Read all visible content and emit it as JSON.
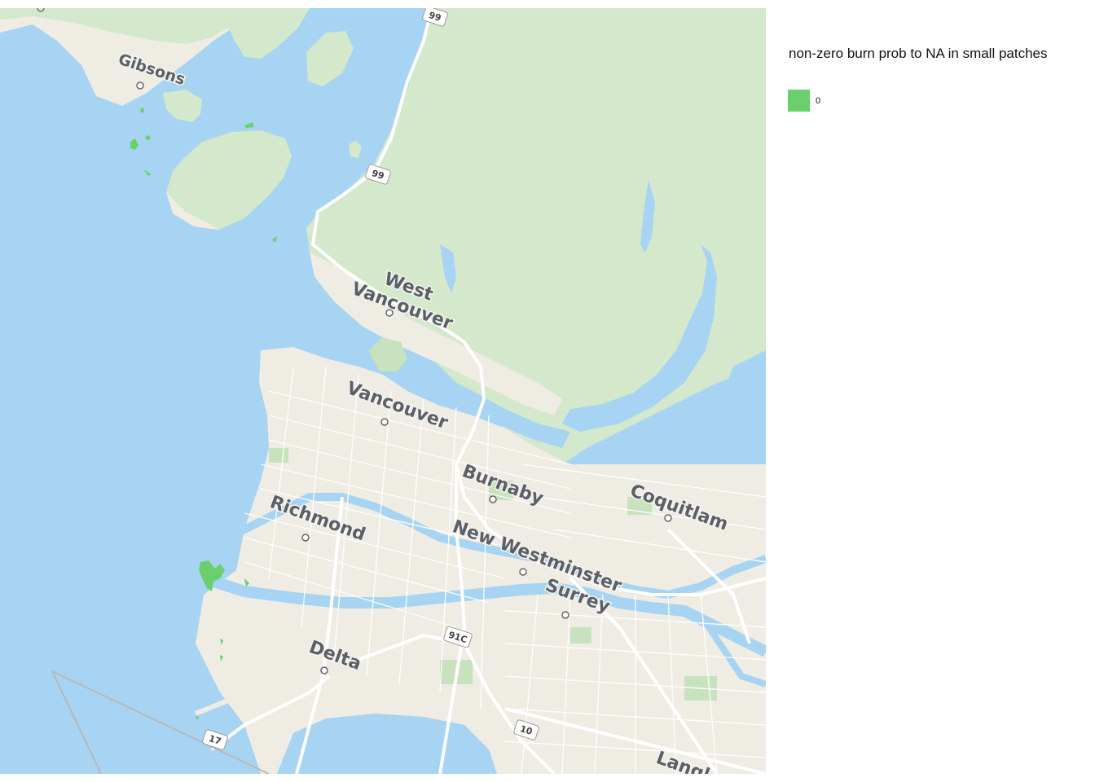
{
  "map": {
    "region": "Greater Vancouver / Howe Sound",
    "colors": {
      "water": "#a6d4f2",
      "land": "#efece4",
      "forest": "#d4e8cb",
      "park": "#c8e2bd",
      "roads": "#ffffff",
      "burn_patch": "#6bcf6e"
    },
    "places": [
      {
        "label": "Gibsons"
      },
      {
        "label": "West"
      },
      {
        "label": "Vancouver"
      },
      {
        "label": "Vancouver"
      },
      {
        "label": "Burnaby"
      },
      {
        "label": "Coquitlam"
      },
      {
        "label": "Richmond"
      },
      {
        "label": "New Westminster"
      },
      {
        "label": "Surrey"
      },
      {
        "label": "Delta"
      },
      {
        "label": "Langl"
      }
    ],
    "shields": [
      {
        "label": "99"
      },
      {
        "label": "99"
      },
      {
        "label": "91C"
      },
      {
        "label": "10"
      },
      {
        "label": "17"
      }
    ]
  },
  "legend": {
    "title": "non-zero burn prob to NA in small patches",
    "items": [
      {
        "label": "0",
        "color": "#6bcf6e"
      }
    ]
  }
}
